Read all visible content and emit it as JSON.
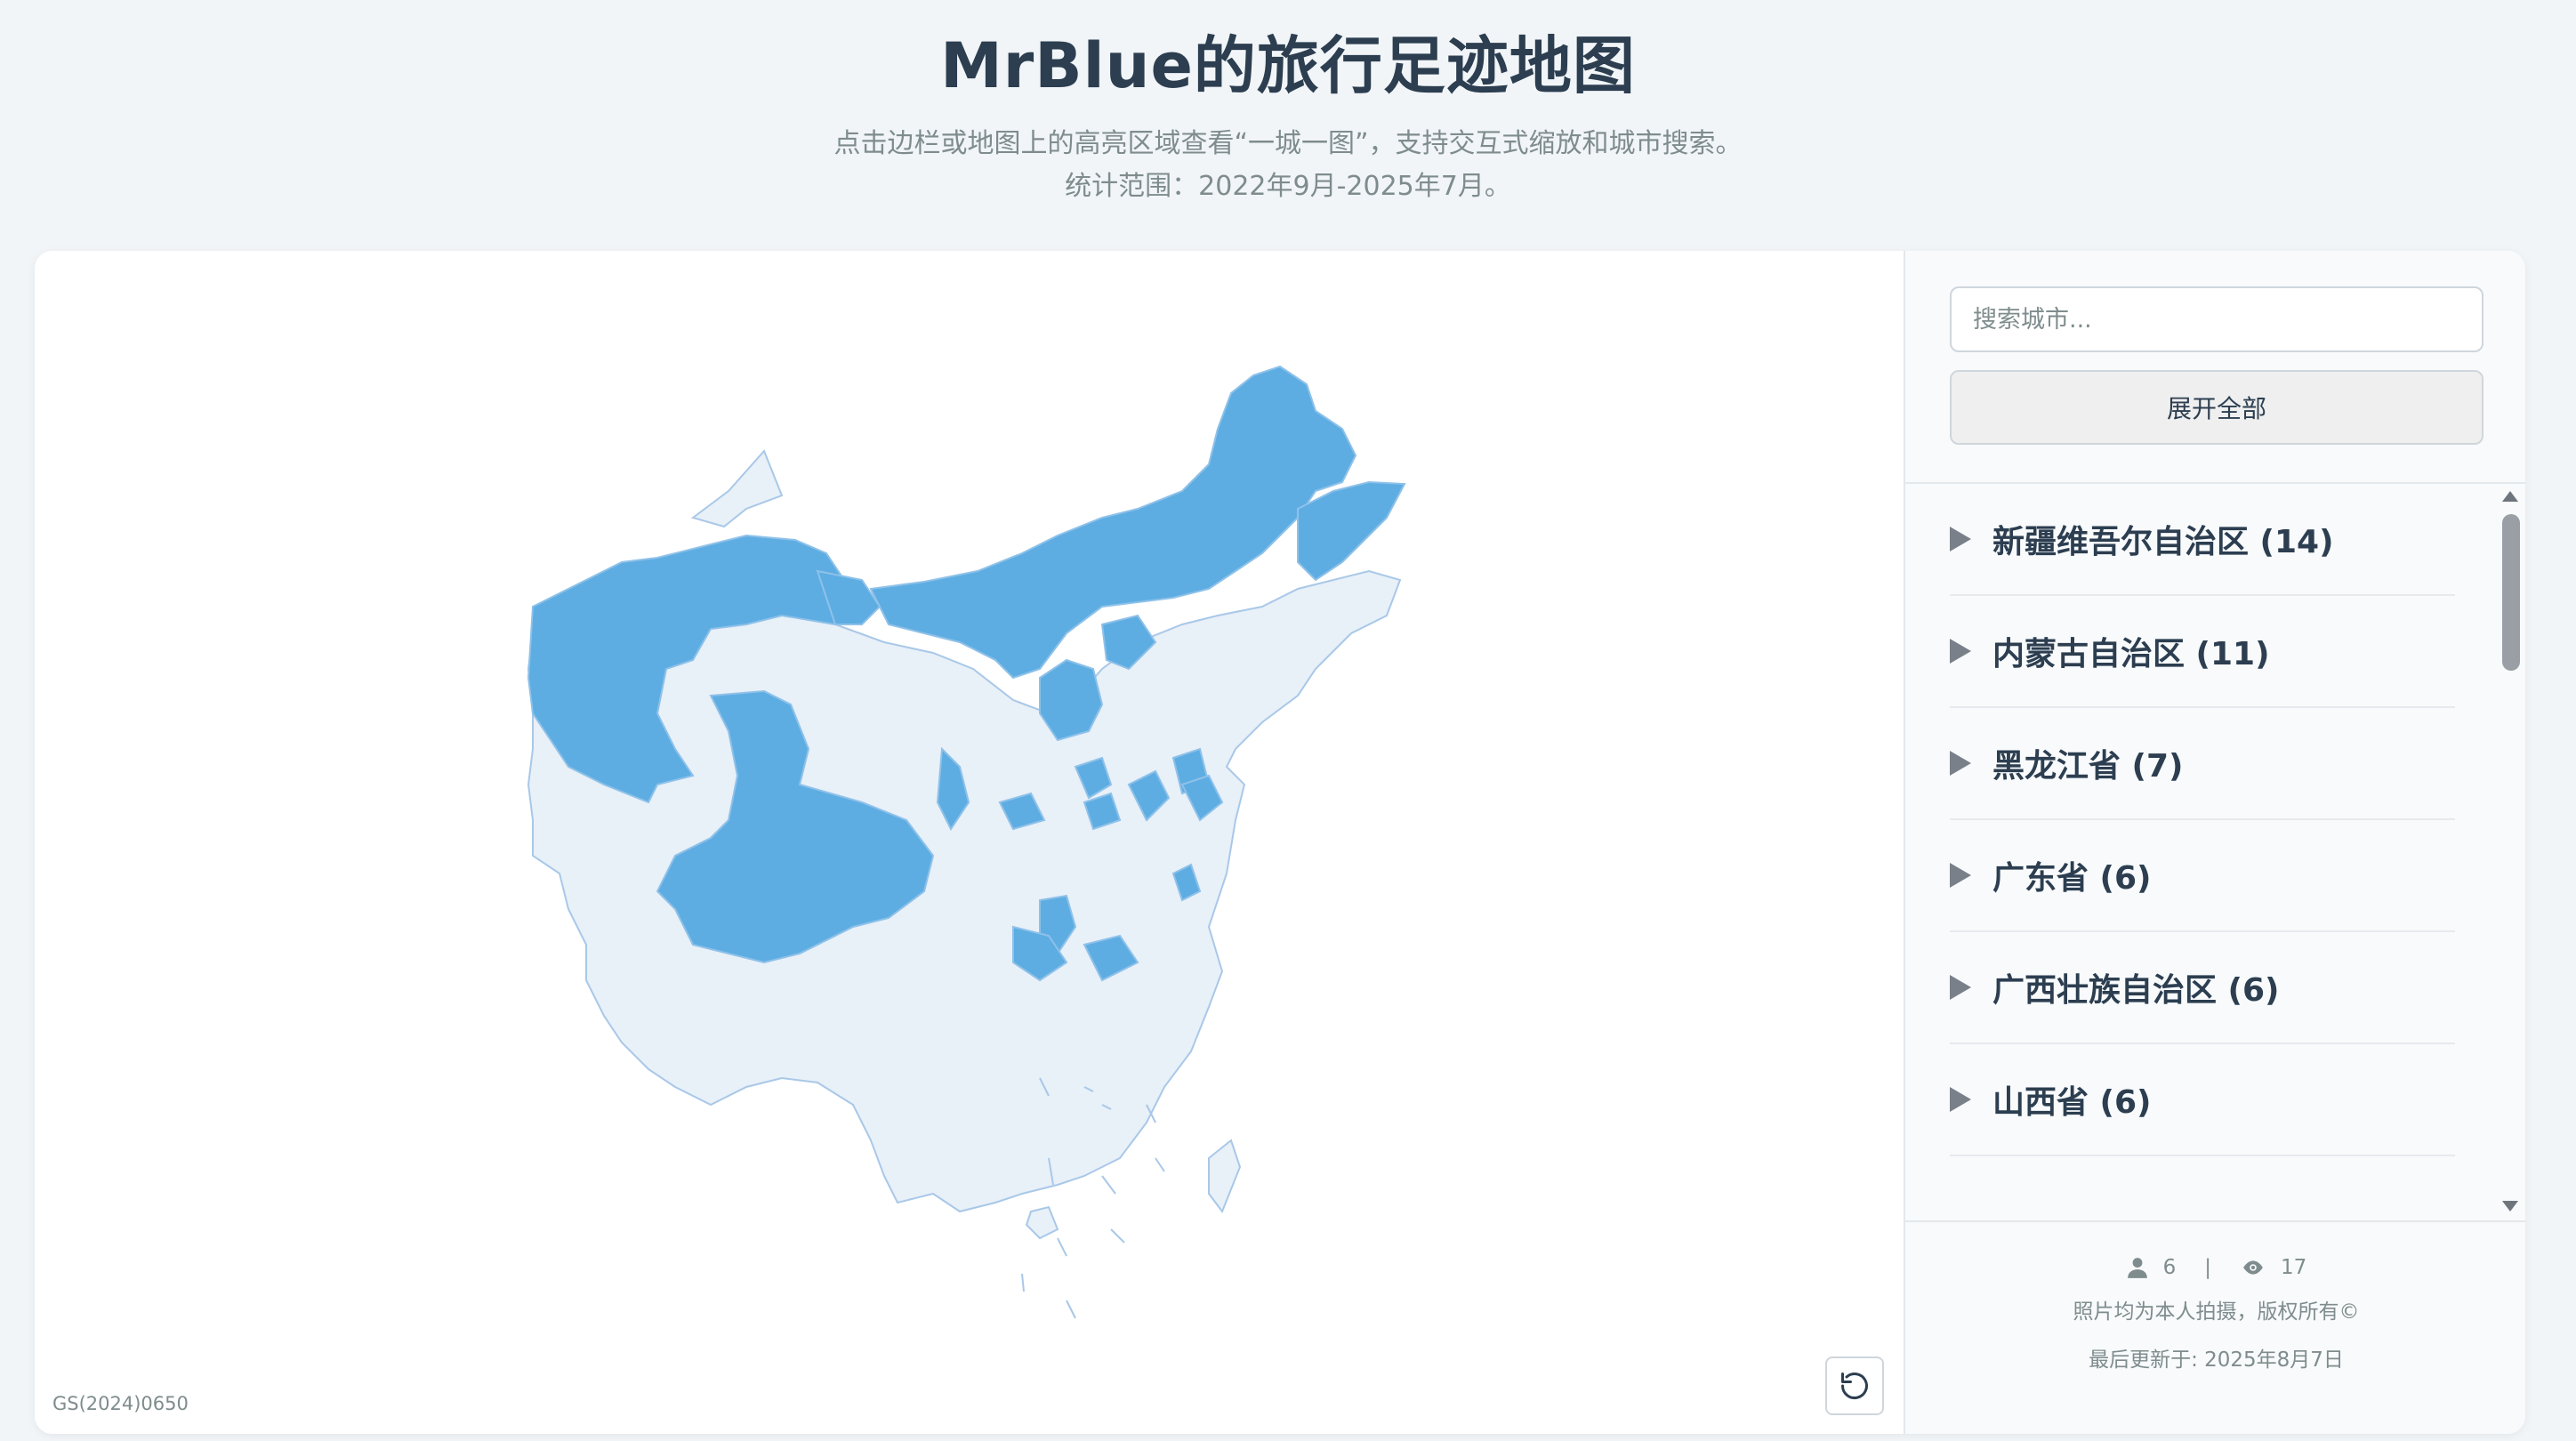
{
  "header": {
    "title": "MrBlue的旅行足迹地图",
    "subtitle_line1": "点击边栏或地图上的高亮区域查看“一城一图”，支持交互式缩放和城市搜索。",
    "subtitle_line2": "统计范围：2022年9月-2025年7月。"
  },
  "map": {
    "code": "GS(2024)0650",
    "highlight_color": "#5dade2",
    "base_color": "#e8f0f8",
    "border_color": "#a9c8e8"
  },
  "sidebar": {
    "search_placeholder": "搜索城市...",
    "expand_button": "展开全部",
    "provinces": [
      {
        "label": "新疆维吾尔自治区 (14)"
      },
      {
        "label": "内蒙古自治区 (11)"
      },
      {
        "label": "黑龙江省 (7)"
      },
      {
        "label": "广东省 (6)"
      },
      {
        "label": "广西壮族自治区 (6)"
      },
      {
        "label": "山西省 (6)"
      }
    ]
  },
  "footer": {
    "visitors": "6",
    "separator": "|",
    "views": "17",
    "copyright": "照片均为本人拍摄，版权所有©",
    "last_updated": "最后更新于: 2025年8月7日"
  }
}
